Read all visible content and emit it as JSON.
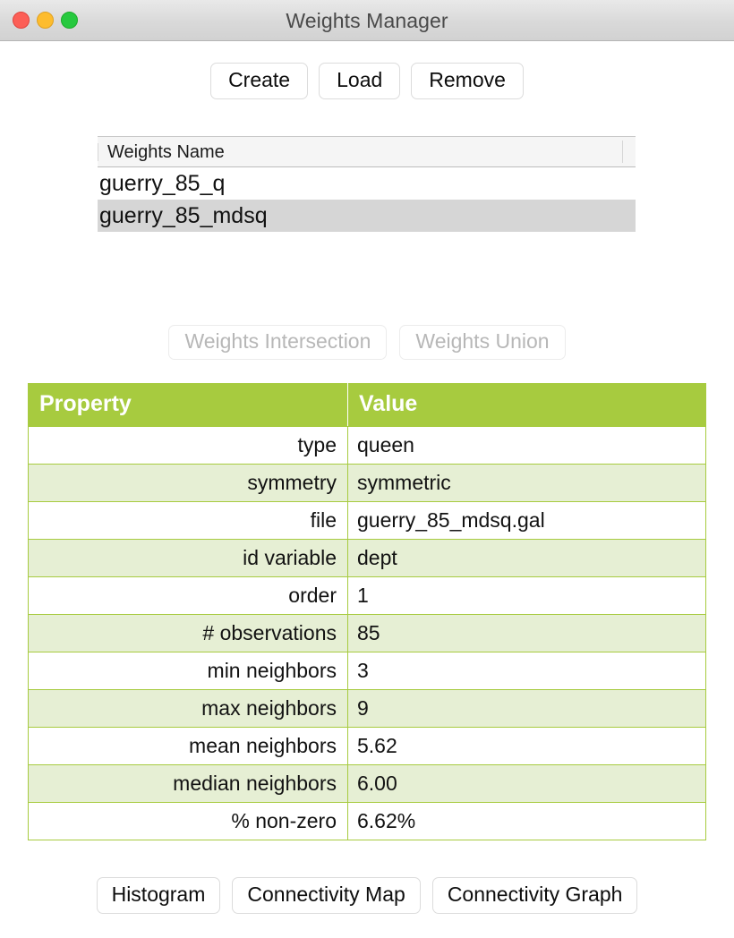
{
  "window": {
    "title": "Weights Manager",
    "controls": [
      {
        "name": "close-button",
        "color": "#fc5f57"
      },
      {
        "name": "minimize-button",
        "color": "#fdbc2d"
      },
      {
        "name": "zoom-button",
        "color": "#27c93f"
      }
    ]
  },
  "toolbar_top": {
    "buttons": [
      {
        "label": "Create",
        "enabled": true
      },
      {
        "label": "Load",
        "enabled": true
      },
      {
        "label": "Remove",
        "enabled": true
      }
    ]
  },
  "weights_list": {
    "column_header": "Weights Name",
    "rows": [
      {
        "name": "guerry_85_q",
        "selected": false
      },
      {
        "name": "guerry_85_mdsq",
        "selected": true
      }
    ]
  },
  "toolbar_mid": {
    "buttons": [
      {
        "label": "Weights Intersection",
        "enabled": false
      },
      {
        "label": "Weights Union",
        "enabled": false
      }
    ]
  },
  "properties": {
    "headers": [
      "Property",
      "Value"
    ],
    "accent_color": "#a7cb3f",
    "row_alt_color": "#e6efd4",
    "rows": [
      {
        "property": "type",
        "value": "queen"
      },
      {
        "property": "symmetry",
        "value": "symmetric"
      },
      {
        "property": "file",
        "value": "guerry_85_mdsq.gal"
      },
      {
        "property": "id variable",
        "value": "dept"
      },
      {
        "property": "order",
        "value": "1"
      },
      {
        "property": "# observations",
        "value": "85"
      },
      {
        "property": "min neighbors",
        "value": "3"
      },
      {
        "property": "max neighbors",
        "value": "9"
      },
      {
        "property": "mean neighbors",
        "value": "5.62"
      },
      {
        "property": "median neighbors",
        "value": "6.00"
      },
      {
        "property": "% non-zero",
        "value": "6.62%"
      }
    ]
  },
  "toolbar_bottom": {
    "buttons": [
      {
        "label": "Histogram",
        "enabled": true
      },
      {
        "label": "Connectivity Map",
        "enabled": true
      },
      {
        "label": "Connectivity Graph",
        "enabled": true
      }
    ]
  }
}
